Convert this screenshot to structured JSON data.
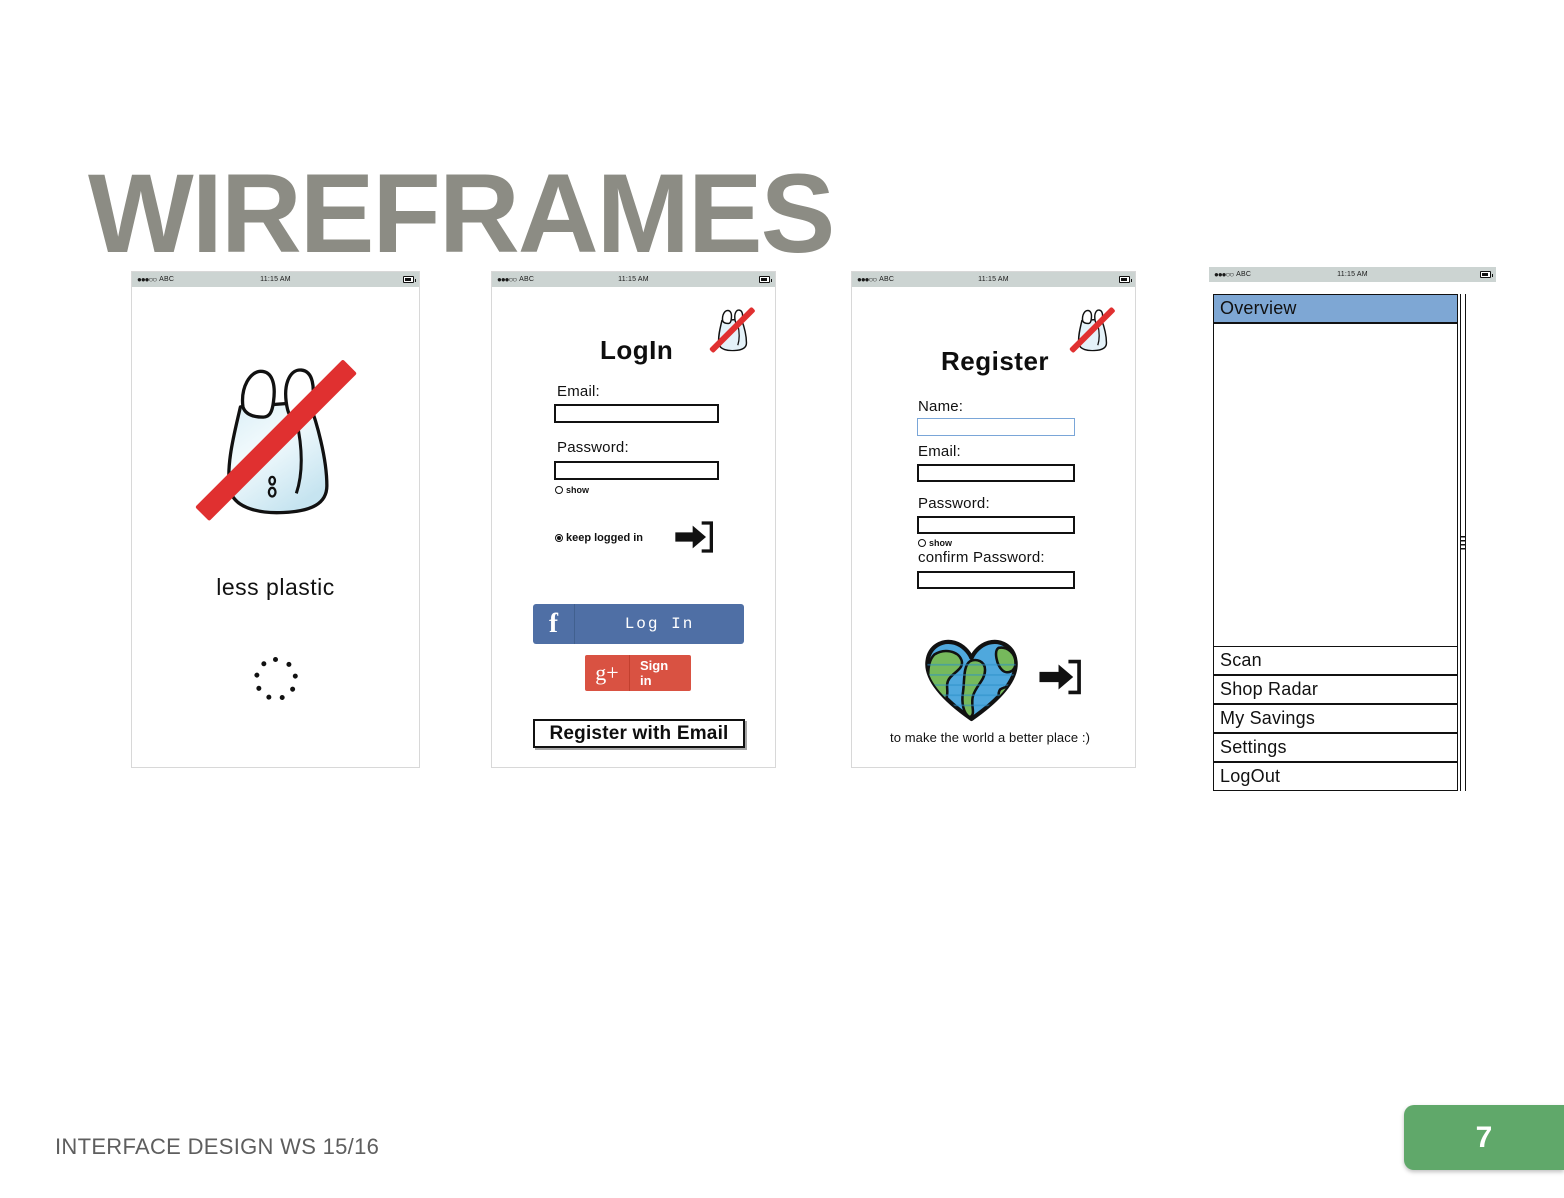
{
  "slide": {
    "title": "WIREFRAMES",
    "footer": "INTERFACE DESIGN WS 15/16",
    "page_number": "7",
    "accent_green": "#60a86a",
    "title_gray": "#8c8c84"
  },
  "status_bar": {
    "signal_dots": "●●●○○",
    "carrier": "ABC",
    "time": "11:15 AM",
    "battery_icon": "battery-icon"
  },
  "screens": [
    {
      "name": "splash",
      "logo_icon": "no-plastic-bag-icon",
      "caption": "less plastic",
      "spinner_icon": "loading-spinner-icon"
    },
    {
      "name": "login",
      "title": "LogIn",
      "logo_icon": "no-plastic-bag-icon",
      "fields": [
        {
          "label": "Email:",
          "value": "",
          "focused": false
        },
        {
          "label": "Password:",
          "value": "",
          "focused": false
        }
      ],
      "show_password": {
        "label": "show",
        "checked": false
      },
      "keep_logged_in": {
        "label": "keep logged in",
        "checked": true
      },
      "submit_icon": "enter-arrow-icon",
      "facebook_button": {
        "icon": "facebook-icon",
        "icon_glyph": "f",
        "label": "Log In",
        "color": "#4f6fa5"
      },
      "google_button": {
        "icon": "google-plus-icon",
        "icon_glyph": "g+",
        "label": "Sign in",
        "color": "#d95242"
      },
      "register_button": "Register with Email"
    },
    {
      "name": "register",
      "title": "Register",
      "logo_icon": "no-plastic-bag-icon",
      "fields": [
        {
          "label": "Name:",
          "value": "",
          "focused": true
        },
        {
          "label": "Email:",
          "value": "",
          "focused": false
        },
        {
          "label": "Password:",
          "value": "",
          "focused": false
        },
        {
          "label": "confirm Password:",
          "value": "",
          "focused": false
        }
      ],
      "show_password": {
        "label": "show",
        "checked": false
      },
      "earth_icon": "earth-heart-icon",
      "submit_icon": "enter-arrow-icon",
      "tagline": "to make the world a better place :)"
    },
    {
      "name": "menu",
      "highlight_color": "#7ea7d4",
      "items": [
        {
          "label": "Overview",
          "active": true
        },
        {
          "label": "Scan",
          "active": false
        },
        {
          "label": "Shop Radar",
          "active": false
        },
        {
          "label": "My Savings",
          "active": false
        },
        {
          "label": "Settings",
          "active": false
        },
        {
          "label": "LogOut",
          "active": false
        }
      ],
      "scrollbar_icon": "scrollbar-grip-icon"
    }
  ]
}
